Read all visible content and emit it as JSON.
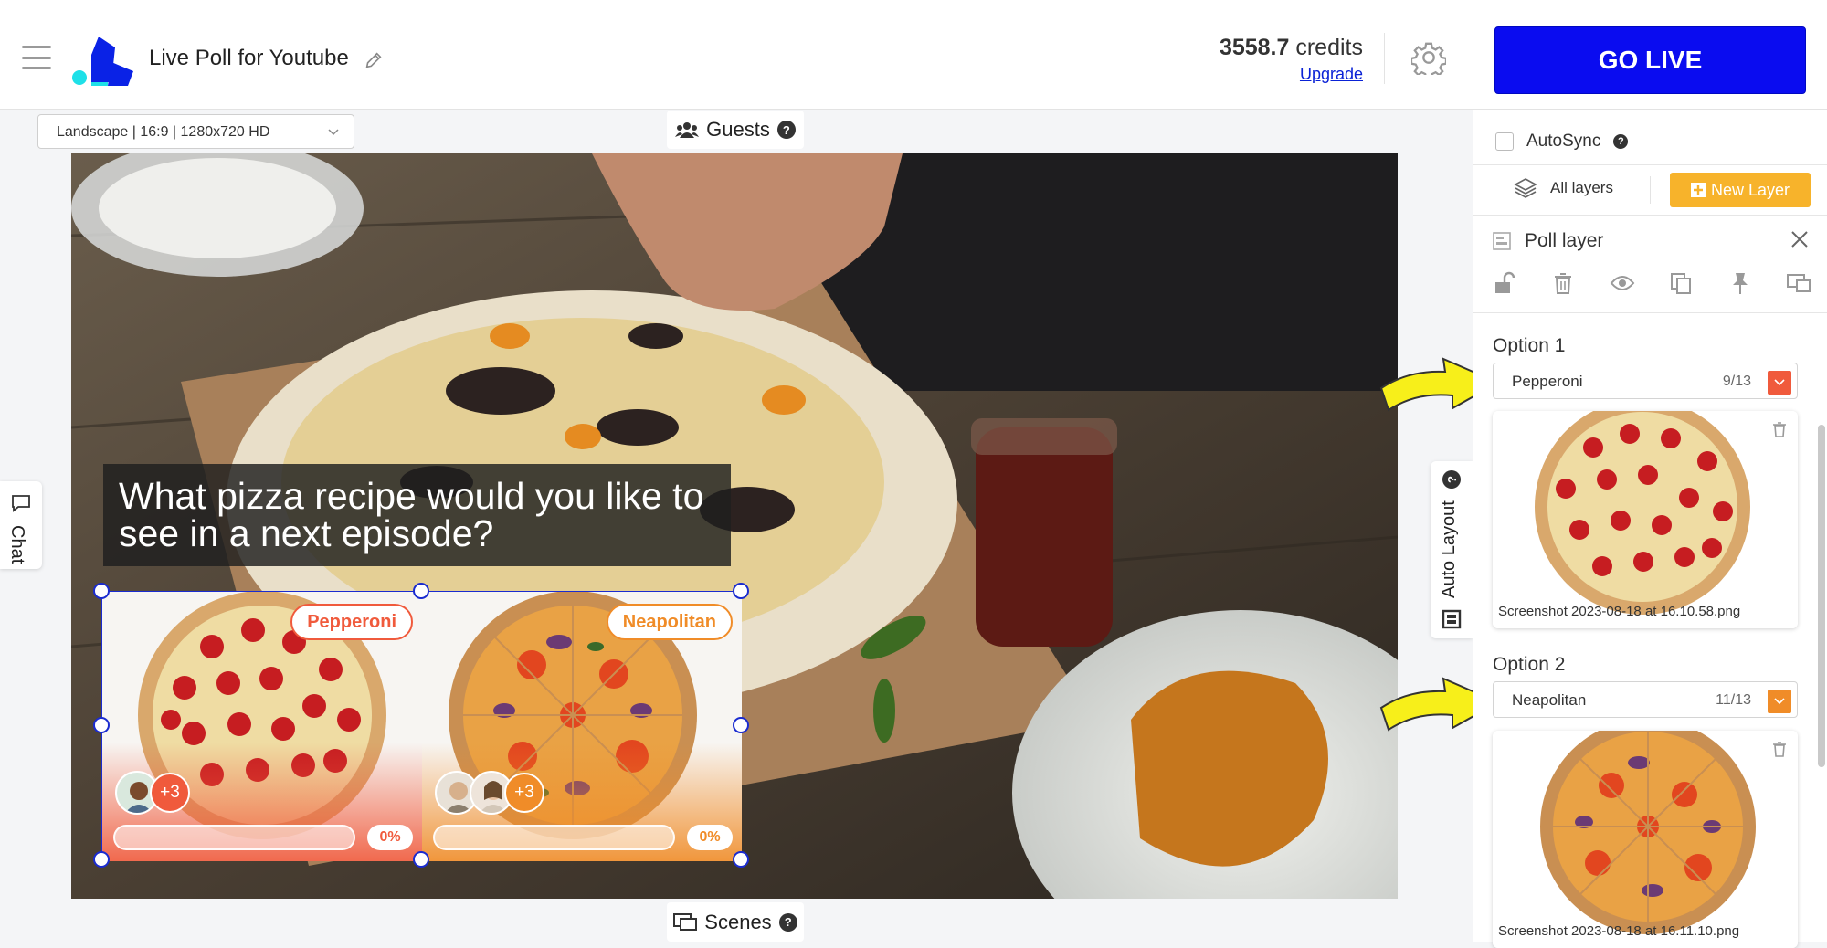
{
  "header": {
    "app_title": "Live Poll for Youtube",
    "credits_value": "3558.7",
    "credits_unit": "credits",
    "upgrade_label": "Upgrade",
    "go_live_label": "GO LIVE"
  },
  "canvas": {
    "format_select_value": "Landscape | 16:9 | 1280x720 HD",
    "guests_label": "Guests",
    "scenes_label": "Scenes",
    "chat_label": "Chat",
    "auto_layout_label": "Auto Layout",
    "question": "What pizza recipe would you like to see in a next episode?",
    "options": [
      {
        "label": "Pepperoni",
        "plus_count": "+3",
        "percent": "0%",
        "progress": 0,
        "color": "#f05a3c"
      },
      {
        "label": "Neapolitan",
        "plus_count": "+3",
        "percent": "0%",
        "progress": 0,
        "color": "#f08c28"
      }
    ]
  },
  "panel": {
    "autosync_label": "AutoSync",
    "all_layers_label": "All layers",
    "new_layer_label": "New Layer",
    "layer_title": "Poll layer",
    "options": [
      {
        "heading": "Option 1",
        "value": "Pepperoni",
        "count": "9/13",
        "color": "#f05a3c",
        "file": "Screenshot 2023-08-18 at 16.10.58.png"
      },
      {
        "heading": "Option 2",
        "value": "Neapolitan",
        "count": "11/13",
        "color": "#f08c28",
        "file": "Screenshot 2023-08-18 at 16.11.10.png"
      }
    ]
  },
  "colors": {
    "go_live": "#0a0cf0",
    "new_layer": "#f7b32b",
    "selection": "#1a2bd0"
  }
}
